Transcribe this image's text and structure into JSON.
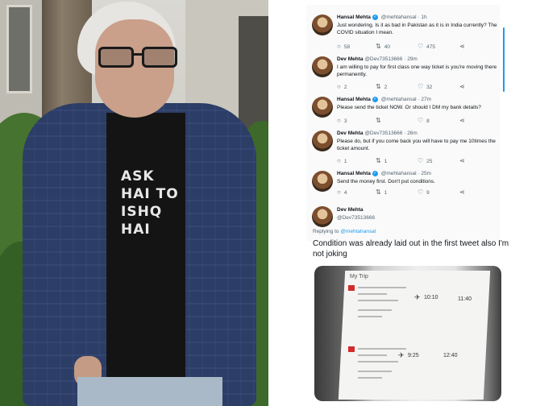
{
  "tweets": [
    {
      "name": "Hansal Mehta",
      "verified": true,
      "handle": "@mehtahansal",
      "time": "· 1h",
      "text": "Just wondering. Is it as bad in Pakistan as it is in India currently? The COVID situation I mean.",
      "replies": "58",
      "retweets": "40",
      "likes": "475"
    },
    {
      "name": "Dev Mehta",
      "verified": false,
      "handle": "@Dev73513666",
      "time": "· 29m",
      "text": "I am willing to pay for first class one way ticket is you're moving there permanently.",
      "replies": "2",
      "retweets": "2",
      "likes": "32"
    },
    {
      "name": "Hansal Mehta",
      "verified": true,
      "handle": "@mehtahansal",
      "time": "· 27m",
      "text": "Please send the ticket NOW. Or should I DM my bank details?",
      "replies": "3",
      "retweets": "",
      "likes": "8"
    },
    {
      "name": "Dev Mehta",
      "verified": false,
      "handle": "@Dev73513666",
      "time": "· 26m",
      "text": "Please do, but if you come back you will have to pay me 10times the ticket amount.",
      "replies": "1",
      "retweets": "1",
      "likes": "25"
    },
    {
      "name": "Hansal Mehta",
      "verified": true,
      "handle": "@mehtahansal",
      "time": "· 25m",
      "text": "Send the money first. Don't put conditions.",
      "replies": "4",
      "retweets": "1",
      "likes": "9"
    }
  ],
  "reply": {
    "name": "Dev Mehta",
    "handle": "@Dev73513666",
    "replying_to_label": "Replying to",
    "replying_to_handle": "@mehtahansal",
    "text": "Condition was already laid out in the first tweet also I'm not joking"
  },
  "image": {
    "title": "My Trip",
    "flights": [
      {
        "depart_time": "10:10",
        "arrive_time": "11:40"
      },
      {
        "depart_time": "9:25",
        "arrive_time": "12:40"
      }
    ]
  },
  "shirt_text": "ASK HAI TO\nISHQ HAI",
  "icons": {
    "reply": "reply-icon",
    "retweet": "retweet-icon",
    "like": "heart-icon",
    "share": "share-icon"
  },
  "colors": {
    "accent": "#1d9bf0",
    "text": "#0f1419",
    "muted": "#536471"
  }
}
